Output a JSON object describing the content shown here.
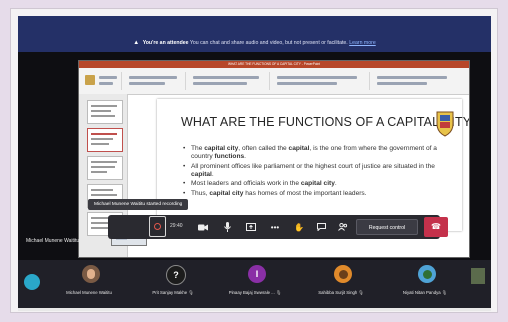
{
  "banner": {
    "title": "You're an attendee",
    "text": "You can chat and share audio and video, but not present or facilitate.",
    "link": "Learn more"
  },
  "presentation": {
    "window_title": "WHAT ARE THE FUNCTIONS OF A CAPITAL CITY - PowerPoint",
    "slide_title": "WHAT ARE THE FUNCTIONS OF A CAPITAL CITY?",
    "bullets": [
      {
        "pre": "The ",
        "b1": "capital city",
        "mid": ", often called the ",
        "b2": "capital",
        "post": ", is the one from where the government of a country ",
        "b3": "functions",
        "end": "."
      },
      {
        "pre": "All prominent offices like parliament or the highest court of justice are situated in the ",
        "b1": "capital",
        "mid": ".",
        "b2": "",
        "post": "",
        "b3": "",
        "end": ""
      },
      {
        "pre": "Most leaders and officials work in the ",
        "b1": "capital city",
        "mid": ".",
        "b2": "",
        "post": "",
        "b3": "",
        "end": ""
      },
      {
        "pre": "Thus, ",
        "b1": "capital city",
        "mid": " has homes of most the important leaders.",
        "b2": "",
        "post": "",
        "b3": "",
        "end": ""
      }
    ]
  },
  "speaker": {
    "name": "Michael Munene Waititu"
  },
  "tooltip": {
    "text": "Michael Munene Waititu started recording"
  },
  "callbar": {
    "timer": "29:40",
    "request_control": "Request control",
    "icons": [
      "record-icon",
      "camera-icon",
      "mic-icon",
      "share-icon",
      "more-icon",
      "hand-icon",
      "chat-icon",
      "people-icon",
      "hangup-icon"
    ]
  },
  "participants": [
    {
      "name": "Michael Munene Waititu",
      "initial": "",
      "color": "#7a5a44"
    },
    {
      "name": "Prit Sanjay Makhe",
      "initial": "?",
      "color": "#1c1c1c"
    },
    {
      "name": "Pinaay Bajaj Swwrale ...",
      "initial": "I",
      "color": "#8a2fa6"
    },
    {
      "name": "Sahibba Surjit Singh",
      "initial": "",
      "color": "#e08a2b"
    },
    {
      "name": "Niyati Nitan Pandya",
      "initial": "",
      "color": "#4fa3d6"
    }
  ]
}
